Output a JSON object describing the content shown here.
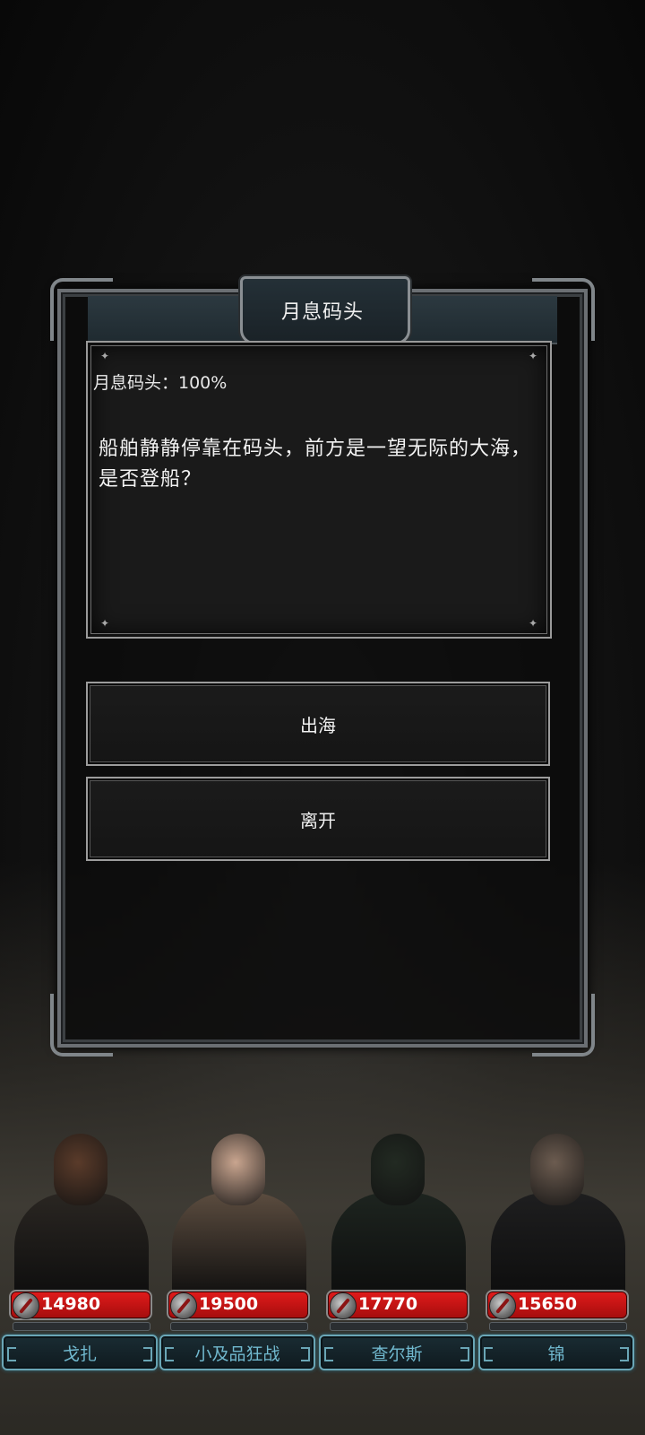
{
  "dialog": {
    "title": "月息码头",
    "status": "月息码头：100%",
    "description": "船舶静静停靠在码头，前方是一望无际的大海，是否登船？",
    "options": [
      {
        "label": "出海"
      },
      {
        "label": "离开"
      }
    ]
  },
  "party": [
    {
      "name": "戈扎",
      "hp": "14980",
      "skin": "#5a3b2a",
      "outfit": "#2a2622"
    },
    {
      "name": "小及品狂战",
      "hp": "19500",
      "skin": "#c9a58f",
      "outfit": "#5b4c3f"
    },
    {
      "name": "查尔斯",
      "hp": "17770",
      "skin": "#222a22",
      "outfit": "#1d241f"
    },
    {
      "name": "锦",
      "hp": "15650",
      "skin": "#6c5c50",
      "outfit": "#1e1e1f"
    }
  ],
  "colors": {
    "hp_bar": "#c91515",
    "name_text": "#71b9cf"
  }
}
